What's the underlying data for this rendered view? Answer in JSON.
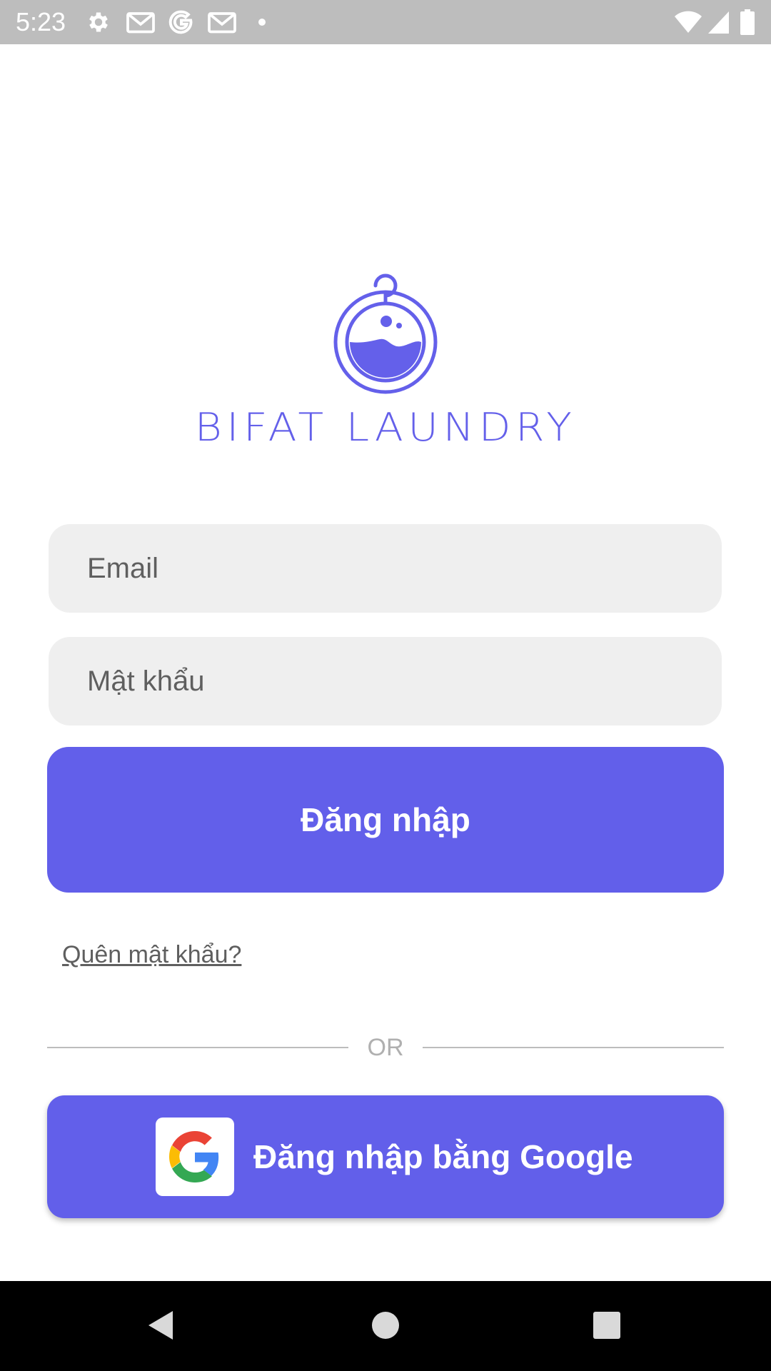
{
  "status_bar": {
    "time": "5:23",
    "left_icons": [
      "settings-icon",
      "gmail-icon",
      "google-icon",
      "gmail-icon",
      "dot-icon"
    ],
    "right_icons": [
      "wifi-icon",
      "signal-icon",
      "battery-icon"
    ]
  },
  "logo": {
    "text": "BIFAT LAUNDRY",
    "icon": "laundry-logo-icon",
    "color": "#6460ea"
  },
  "form": {
    "email_placeholder": "Email",
    "email_value": "",
    "password_placeholder": "Mật khẩu",
    "password_value": "",
    "login_label": "Đăng nhập",
    "forgot_label": "Quên mật khẩu?",
    "divider_label": "OR",
    "google_label": "Đăng nhập bằng Google"
  },
  "colors": {
    "primary": "#625fea",
    "field_bg": "#efefef",
    "status_bar": "#bdbdbd",
    "nav_bar": "#000000"
  },
  "nav_bar": {
    "buttons": [
      "back-icon",
      "home-icon",
      "recents-icon"
    ]
  }
}
